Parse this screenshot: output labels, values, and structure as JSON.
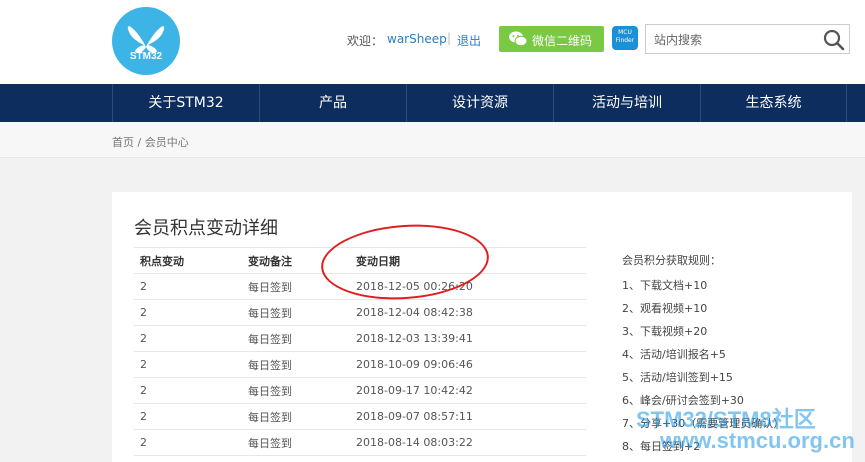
{
  "header": {
    "logo_text": "STM32",
    "welcome": "欢迎：",
    "username": "warSheep",
    "separator": "|",
    "logout": "退出",
    "wechat_qr": "微信二维码",
    "finder_text": "MCU Finder",
    "search_placeholder": "站内搜索"
  },
  "nav": {
    "items": [
      {
        "label": "关于STM32"
      },
      {
        "label": "产品"
      },
      {
        "label": "设计资源"
      },
      {
        "label": "活动与培训"
      },
      {
        "label": "生态系统"
      }
    ]
  },
  "breadcrumb": "首页 / 会员中心",
  "main": {
    "title": "会员积点变动详细",
    "columns": [
      "积点变动",
      "变动备注",
      "变动日期"
    ],
    "rows": [
      [
        "2",
        "每日签到",
        "2018-12-05 00:26:20"
      ],
      [
        "2",
        "每日签到",
        "2018-12-04 08:42:38"
      ],
      [
        "2",
        "每日签到",
        "2018-12-03 13:39:41"
      ],
      [
        "2",
        "每日签到",
        "2018-10-09 09:06:46"
      ],
      [
        "2",
        "每日签到",
        "2018-09-17 10:42:42"
      ],
      [
        "2",
        "每日签到",
        "2018-09-07 08:57:11"
      ],
      [
        "2",
        "每日签到",
        "2018-08-14 08:03:22"
      ]
    ]
  },
  "rules": {
    "title": "会员积分获取规则：",
    "items": [
      "1、下载文档+10",
      "2、观看视频+10",
      "3、下载视频+20",
      "4、活动/培训报名+5",
      "5、活动/培训签到+15",
      "6、峰会/研讨会签到+30",
      "7、分享+30（需要管理员确认）",
      "8、每日签到+2"
    ]
  },
  "watermark": {
    "line1": "STM32/STM8社区",
    "line2": "www.stmcu.org.cn"
  },
  "colors": {
    "nav_bg": "#0d2d5e",
    "accent": "#3cb4e5",
    "wechat": "#7ac943",
    "annotation": "#e01e1e"
  }
}
